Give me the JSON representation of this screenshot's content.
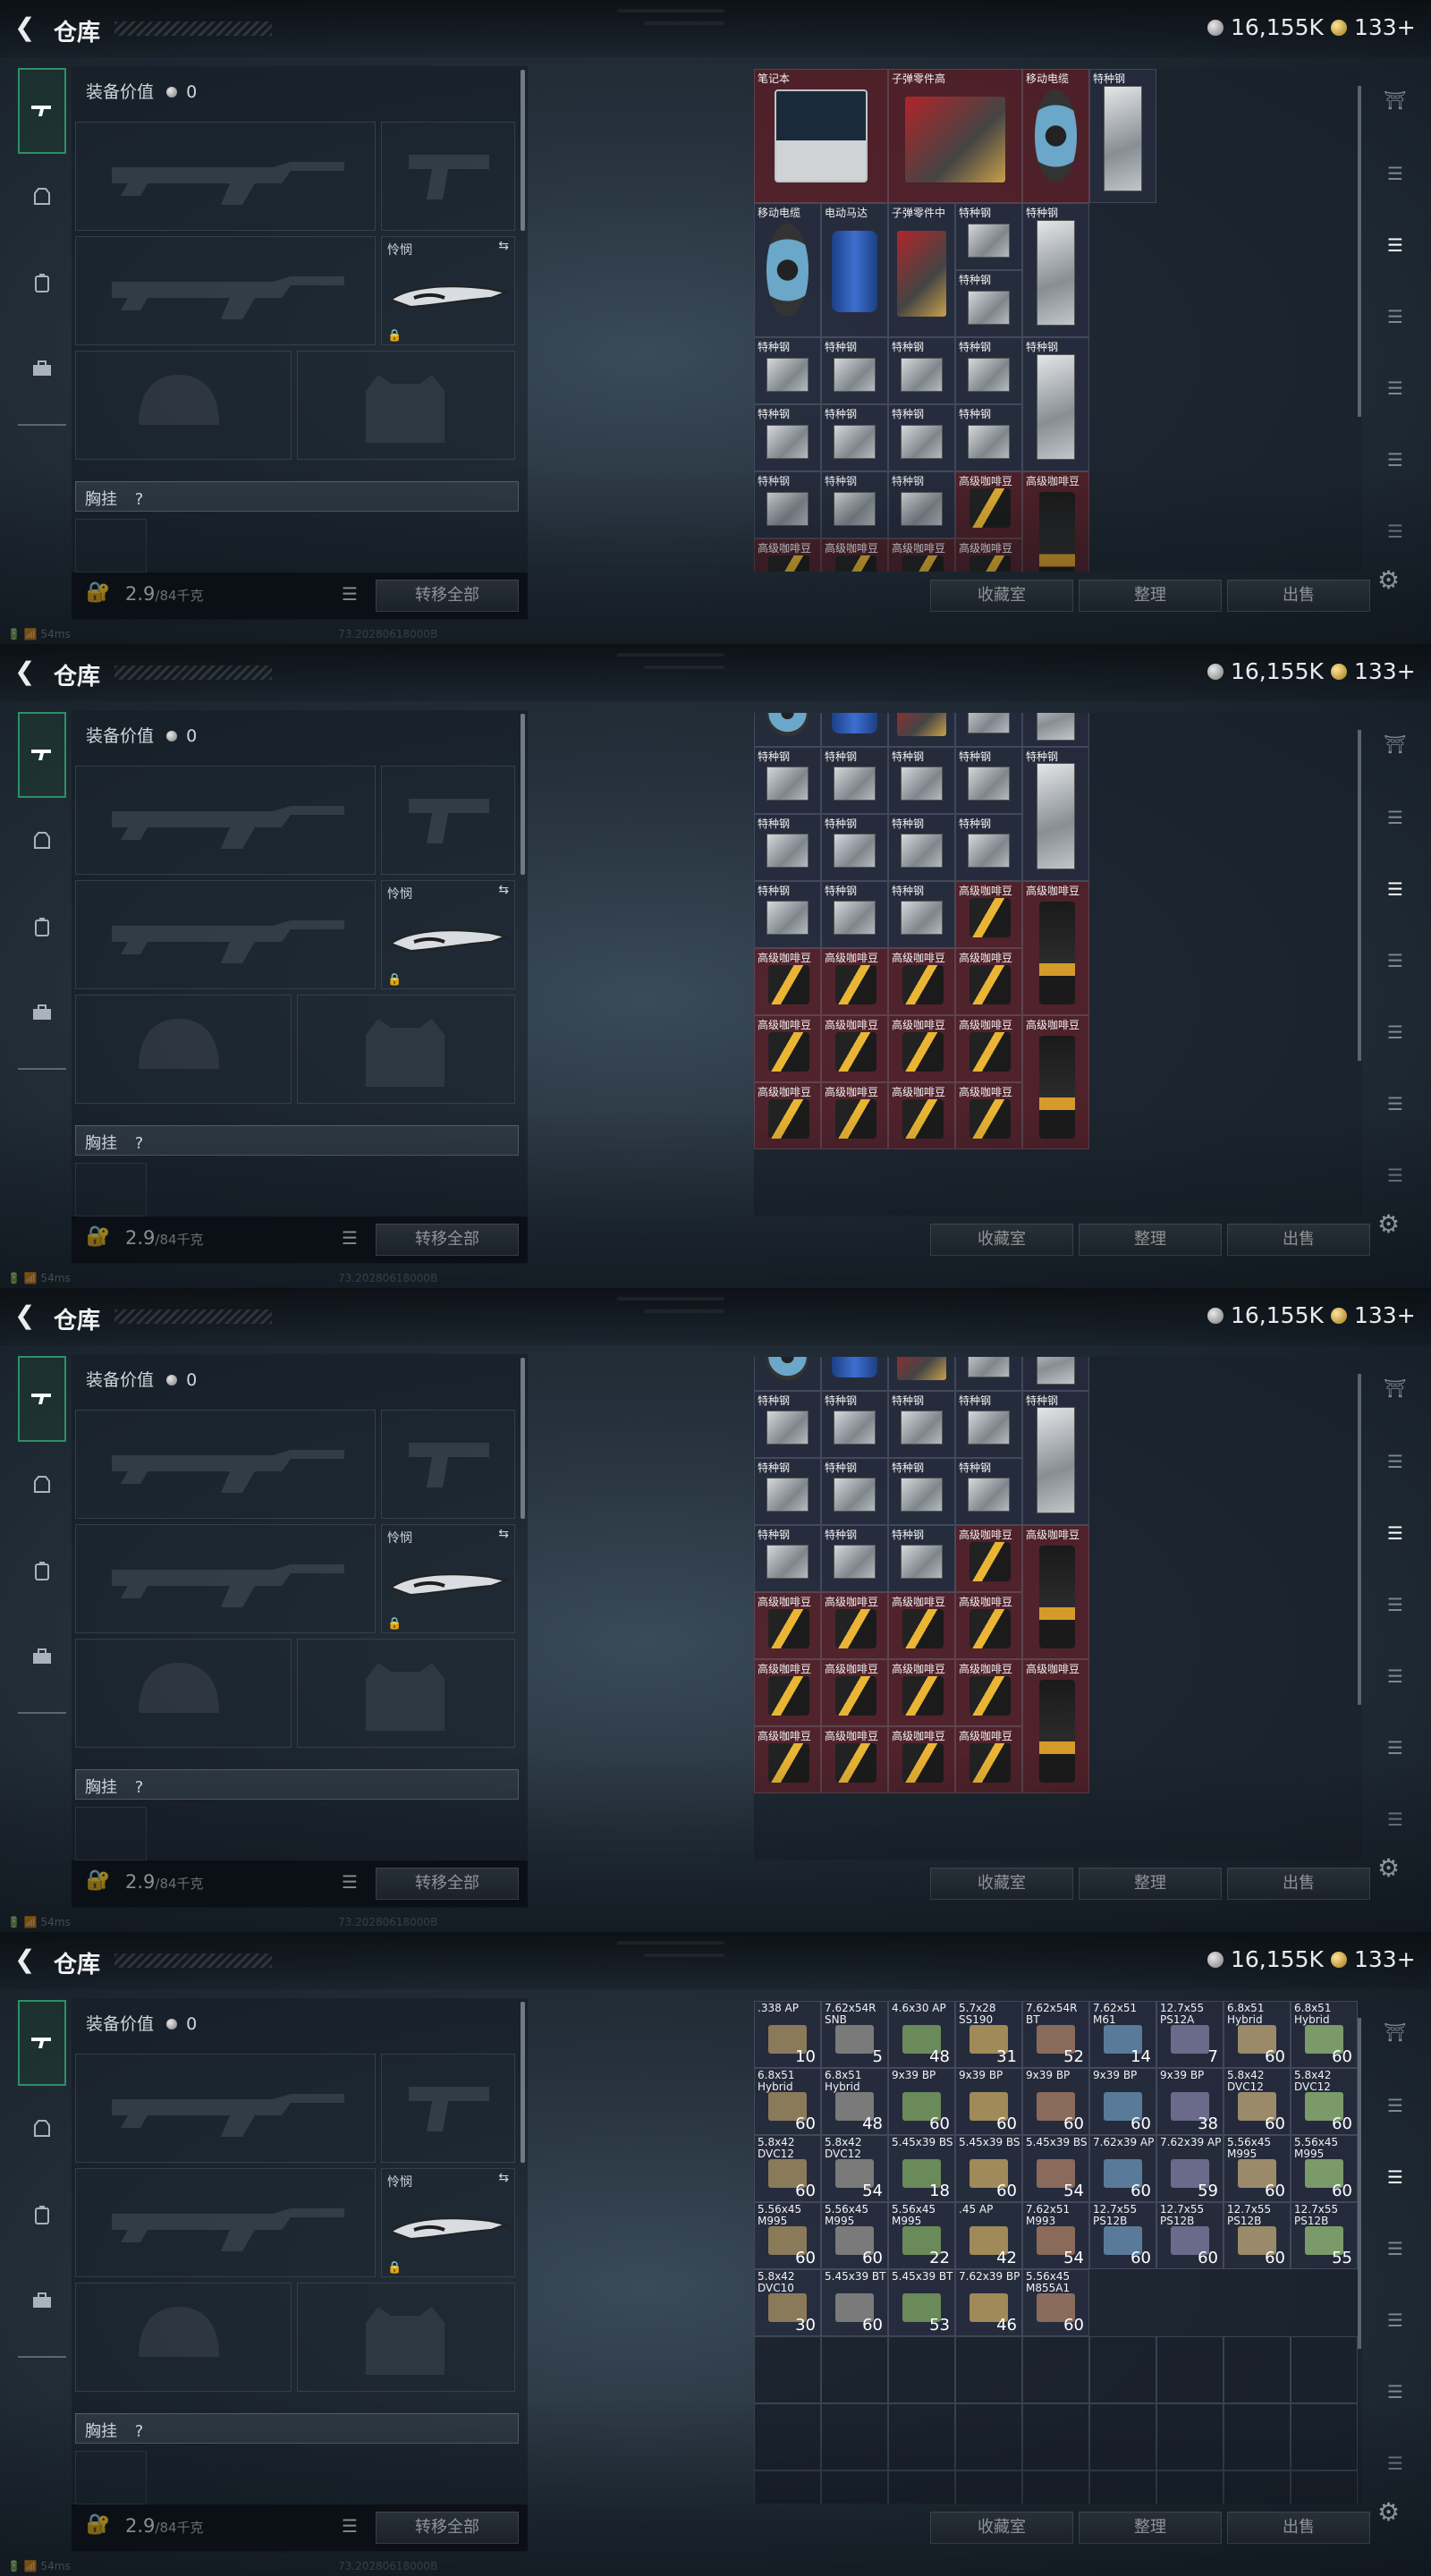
{
  "header": {
    "title": "仓库",
    "silver": "16,155K",
    "gold": "133+"
  },
  "left": {
    "equip_value_label": "装备价值",
    "equip_value": "0",
    "melee_label": "怜悯",
    "chest_rig_label": "胸挂",
    "chest_rig_help": "?",
    "weight": "2.9",
    "weight_max": "/84千克",
    "transfer_all": "转移全部"
  },
  "actions": {
    "collection": "收藏室",
    "organize": "整理",
    "sell": "出售"
  },
  "status": {
    "ping": "54ms",
    "build": "73.20280618000B"
  },
  "icons": {
    "back": "back-arrow-icon",
    "rifle": "rifle-icon",
    "helmet": "helmet-icon",
    "backpack": "backpack-icon",
    "briefcase": "briefcase-icon",
    "gear": "gear-icon"
  },
  "labels": {
    "laptop": "笔记本",
    "bullet_parts_high": "子弹零件高",
    "cable_reel": "移动电缆",
    "special_steel": "特种钢",
    "motor": "电动马达",
    "bullet_parts_mid": "子弹零件中",
    "coffee": "高级咖啡豆"
  },
  "ammo": [
    {
      "label": ".338 AP",
      "count": "10"
    },
    {
      "label": "7.62x54R SNB",
      "count": "5"
    },
    {
      "label": "4.6x30 AP",
      "count": "48"
    },
    {
      "label": "5.7x28 SS190",
      "count": "31"
    },
    {
      "label": "7.62x54R BT",
      "count": "52"
    },
    {
      "label": "7.62x51 M61",
      "count": "14"
    },
    {
      "label": "12.7x55 PS12A",
      "count": "7"
    },
    {
      "label": "6.8x51 Hybrid",
      "count": "60"
    },
    {
      "label": "6.8x51 Hybrid",
      "count": "60"
    },
    {
      "label": "6.8x51 Hybrid",
      "count": "60"
    },
    {
      "label": "6.8x51 Hybrid",
      "count": "48"
    },
    {
      "label": "9x39 BP",
      "count": "60"
    },
    {
      "label": "9x39 BP",
      "count": "60"
    },
    {
      "label": "9x39 BP",
      "count": "60"
    },
    {
      "label": "9x39 BP",
      "count": "60"
    },
    {
      "label": "9x39 BP",
      "count": "38"
    },
    {
      "label": "5.8x42 DVC12",
      "count": "60"
    },
    {
      "label": "5.8x42 DVC12",
      "count": "60"
    },
    {
      "label": "5.8x42 DVC12",
      "count": "60"
    },
    {
      "label": "5.8x42 DVC12",
      "count": "54"
    },
    {
      "label": "5.45x39 BS",
      "count": "18"
    },
    {
      "label": "5.45x39 BS",
      "count": "60"
    },
    {
      "label": "5.45x39 BS",
      "count": "54"
    },
    {
      "label": "7.62x39 AP",
      "count": "60"
    },
    {
      "label": "7.62x39 AP",
      "count": "59"
    },
    {
      "label": "5.56x45 M995",
      "count": "60"
    },
    {
      "label": "5.56x45 M995",
      "count": "60"
    },
    {
      "label": "5.56x45 M995",
      "count": "60"
    },
    {
      "label": "5.56x45 M995",
      "count": "60"
    },
    {
      "label": "5.56x45 M995",
      "count": "22"
    },
    {
      "label": ".45 AP",
      "count": "42"
    },
    {
      "label": "7.62x51 M993",
      "count": "54"
    },
    {
      "label": "12.7x55 PS12B",
      "count": "60"
    },
    {
      "label": "12.7x55 PS12B",
      "count": "60"
    },
    {
      "label": "12.7x55 PS12B",
      "count": "60"
    },
    {
      "label": "12.7x55 PS12B",
      "count": "55"
    },
    {
      "label": "5.8x42 DVC10",
      "count": "30"
    },
    {
      "label": "5.45x39 BT",
      "count": "60"
    },
    {
      "label": "5.45x39 BT",
      "count": "53"
    },
    {
      "label": "7.62x39 BP",
      "count": "46"
    },
    {
      "label": "5.56x45 M855A1",
      "count": "60"
    }
  ]
}
